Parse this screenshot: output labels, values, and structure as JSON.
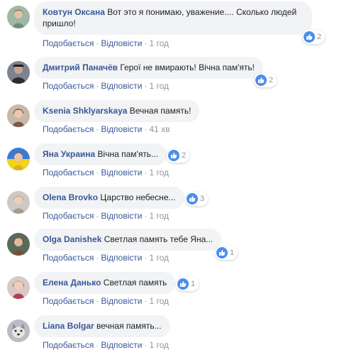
{
  "labels": {
    "like": "Подобається",
    "reply": "Відповісти",
    "sep": "·"
  },
  "comments": [
    {
      "author": "Ковтун Оксана",
      "text": "Вот это я понимаю, уважение.... Сколько людей\nпришло!",
      "time": "1 год",
      "likes": "2",
      "avatar_color": "#6d8f7a"
    },
    {
      "author": "Дмитрий Паначёв",
      "text": "Герої не вмирають! Вічна пам'ять!",
      "time": "1 год",
      "likes": "2",
      "avatar_color": "#3a3a3a"
    },
    {
      "author": "Ksenia Shklyarskaya",
      "text": "Вечная память!",
      "time": "41 хв",
      "likes": "",
      "avatar_color": "#7a5a48"
    },
    {
      "author": "Яна Украина",
      "text": "Вічна пам'ять...",
      "time": "1 год",
      "likes": "2",
      "avatar_color": "#d9b320"
    },
    {
      "author": "Olena Brovko",
      "text": "Царство небесне...",
      "time": "1 год",
      "likes": "3",
      "avatar_color": "#a59a90"
    },
    {
      "author": "Olga Danishek",
      "text": "Светлая память тебе Яна...",
      "time": "1 год",
      "likes": "1",
      "avatar_color": "#7a4d3d"
    },
    {
      "author": "Елена Данько",
      "text": "Светлая память",
      "time": "1 год",
      "likes": "1",
      "avatar_color": "#b04050"
    },
    {
      "author": "Liana Bolgar",
      "text": "вечная память...",
      "time": "1 год",
      "likes": "",
      "avatar_color": "#8c8f98"
    }
  ]
}
